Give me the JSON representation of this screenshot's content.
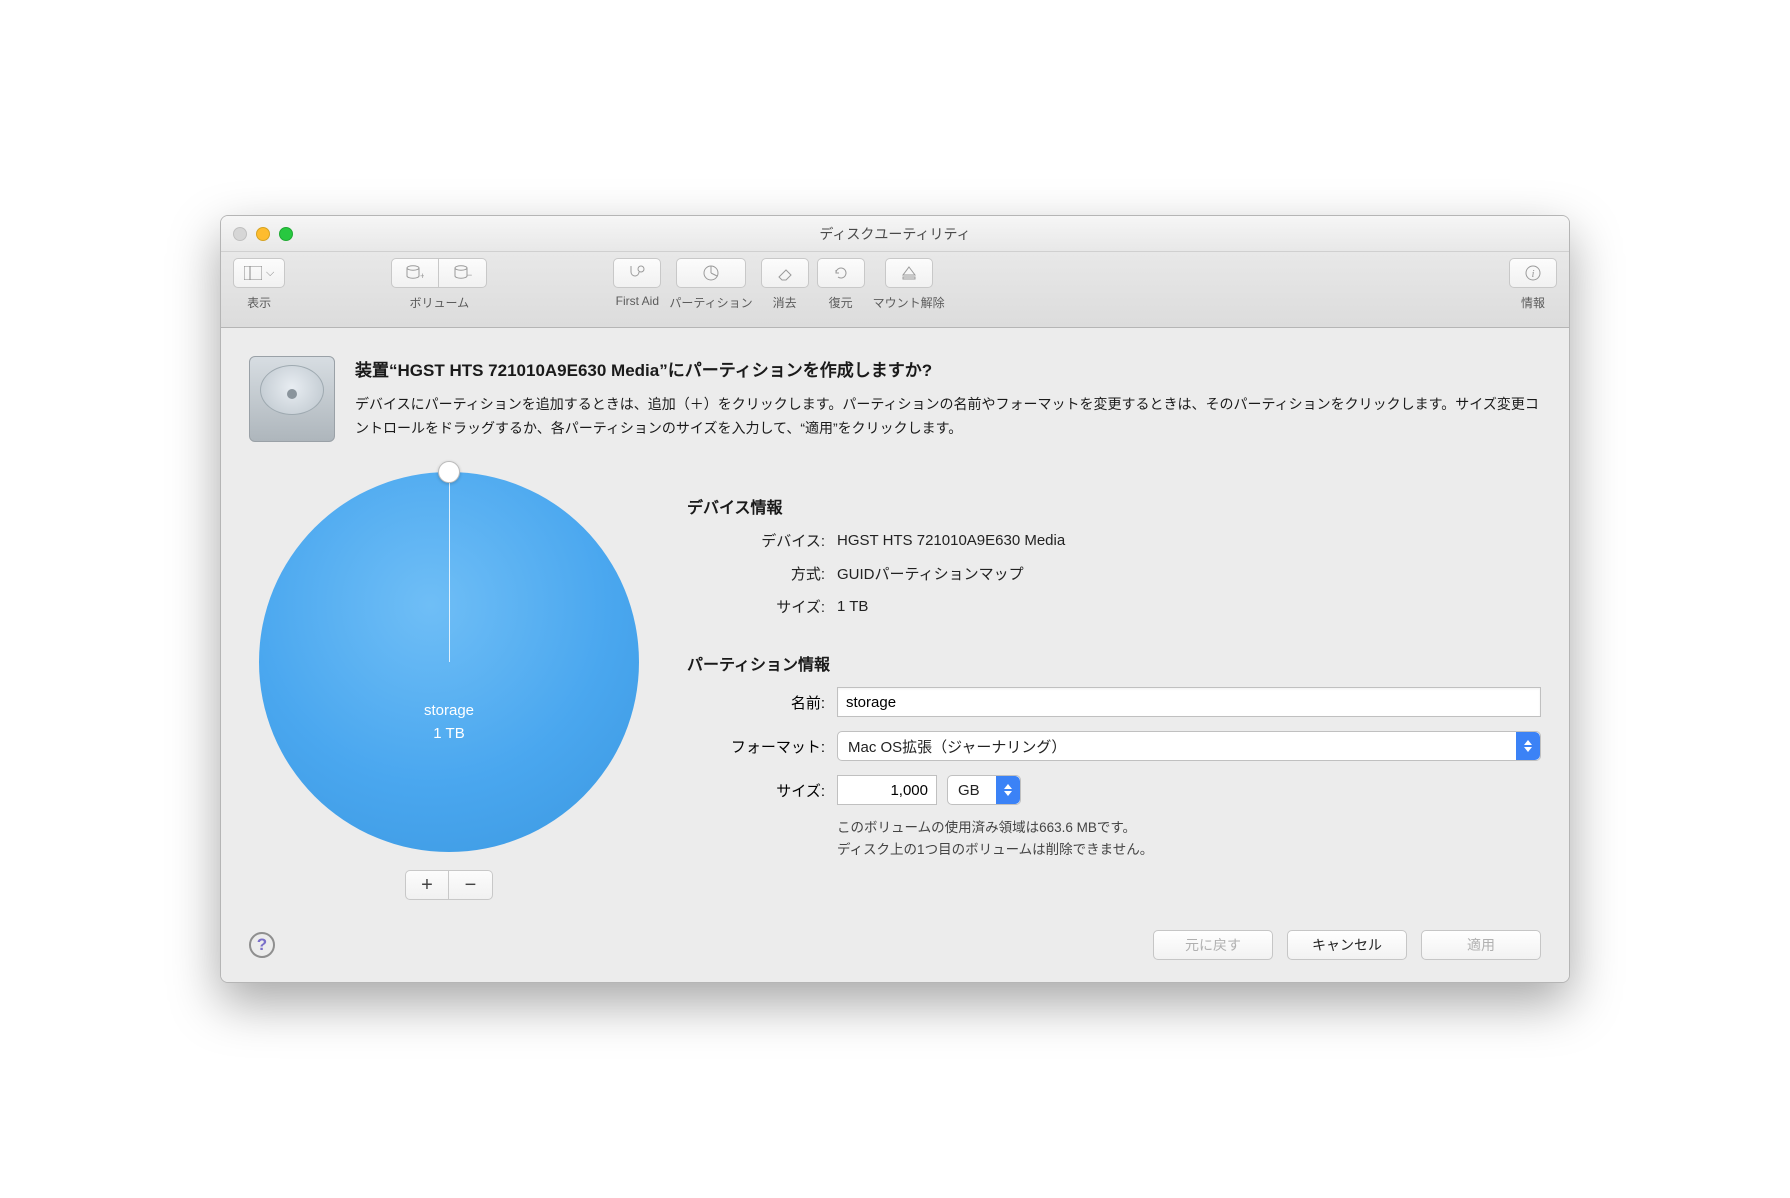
{
  "window": {
    "title": "ディスクユーティリティ"
  },
  "toolbar": {
    "view": "表示",
    "volume": "ボリューム",
    "first_aid": "First Aid",
    "partition": "パーティション",
    "erase": "消去",
    "restore": "復元",
    "unmount": "マウント解除",
    "info": "情報"
  },
  "sheet": {
    "heading": "装置“HGST HTS 721010A9E630 Media”にパーティションを作成しますか?",
    "description": "デバイスにパーティションを追加するときは、追加（＋）をクリックします。パーティションの名前やフォーマットを変更するときは、そのパーティションをクリックします。サイズ変更コントロールをドラッグするか、各パーティションのサイズを入力して、“適用”をクリックします。"
  },
  "pie": {
    "partition_name": "storage",
    "partition_size": "1 TB"
  },
  "device_info": {
    "title": "デバイス情報",
    "device_label": "デバイス:",
    "device_value": "HGST HTS 721010A9E630 Media",
    "scheme_label": "方式:",
    "scheme_value": "GUIDパーティションマップ",
    "size_label": "サイズ:",
    "size_value": "1 TB"
  },
  "partition_info": {
    "title": "パーティション情報",
    "name_label": "名前:",
    "name_value": "storage",
    "format_label": "フォーマット:",
    "format_value": "Mac OS拡張（ジャーナリング）",
    "size_label": "サイズ:",
    "size_value": "1,000",
    "size_unit": "GB",
    "hint1": "このボリュームの使用済み領域は663.6 MBです。",
    "hint2": "ディスク上の1つ目のボリュームは削除できません。"
  },
  "footer": {
    "revert": "元に戻す",
    "cancel": "キャンセル",
    "apply": "適用"
  }
}
